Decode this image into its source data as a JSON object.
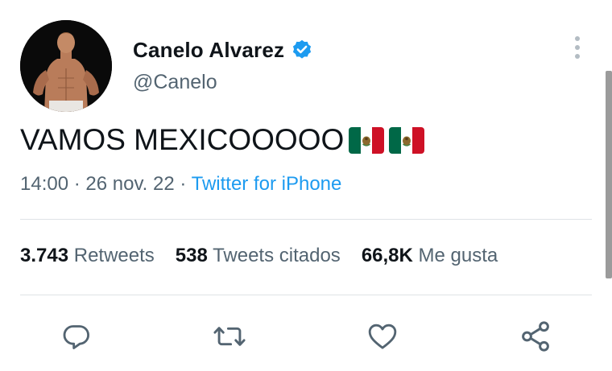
{
  "author": {
    "name": "Canelo Alvarez",
    "handle": "@Canelo",
    "verified": true,
    "verified_color": "#1d9bf0"
  },
  "tweet": {
    "text": "VAMOS MEXICOOOOO",
    "emoji": [
      "mexico-flag",
      "mexico-flag"
    ]
  },
  "meta": {
    "time": "14:00",
    "separator": " · ",
    "date": "26 nov. 22",
    "source": "Twitter for iPhone"
  },
  "stats": [
    {
      "value": "3.743",
      "label": "Retweets"
    },
    {
      "value": "538",
      "label": "Tweets citados"
    },
    {
      "value": "66,8K",
      "label": "Me gusta"
    }
  ],
  "actions": [
    "reply-icon",
    "retweet-icon",
    "like-icon",
    "share-icon"
  ],
  "colors": {
    "text_primary": "#0f1419",
    "text_secondary": "#536471",
    "link": "#1d9bf0",
    "divider": "#dfe3e6"
  }
}
